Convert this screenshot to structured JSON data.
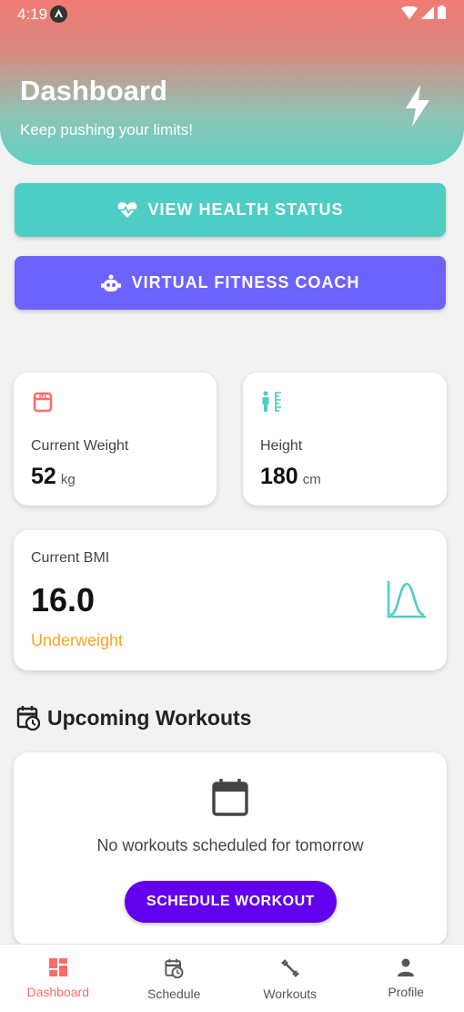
{
  "status_bar": {
    "time": "4:19"
  },
  "header": {
    "title": "Dashboard",
    "subtitle": "Keep pushing your limits!"
  },
  "actions": {
    "health_label": "VIEW HEALTH STATUS",
    "coach_label": "VIRTUAL FITNESS COACH"
  },
  "stats": {
    "weight": {
      "label": "Current Weight",
      "value": "52",
      "unit": "kg"
    },
    "height": {
      "label": "Height",
      "value": "180",
      "unit": "cm"
    },
    "bmi": {
      "label": "Current BMI",
      "value": "16.0",
      "status": "Underweight"
    }
  },
  "upcoming": {
    "title": "Upcoming Workouts",
    "empty_text": "No workouts scheduled for tomorrow",
    "button_label": "SCHEDULE WORKOUT"
  },
  "nav": {
    "items": [
      {
        "label": "Dashboard",
        "icon": "dashboard-icon",
        "active": true
      },
      {
        "label": "Schedule",
        "icon": "calendar-clock-icon",
        "active": false
      },
      {
        "label": "Workouts",
        "icon": "dumbbell-icon",
        "active": false
      },
      {
        "label": "Profile",
        "icon": "person-icon",
        "active": false
      }
    ]
  },
  "colors": {
    "accent_teal": "#4ecdc4",
    "accent_purple": "#6c63ff",
    "accent_red": "#ff6b6b",
    "primary_button": "#6200ee",
    "warning": "#f5a623"
  }
}
